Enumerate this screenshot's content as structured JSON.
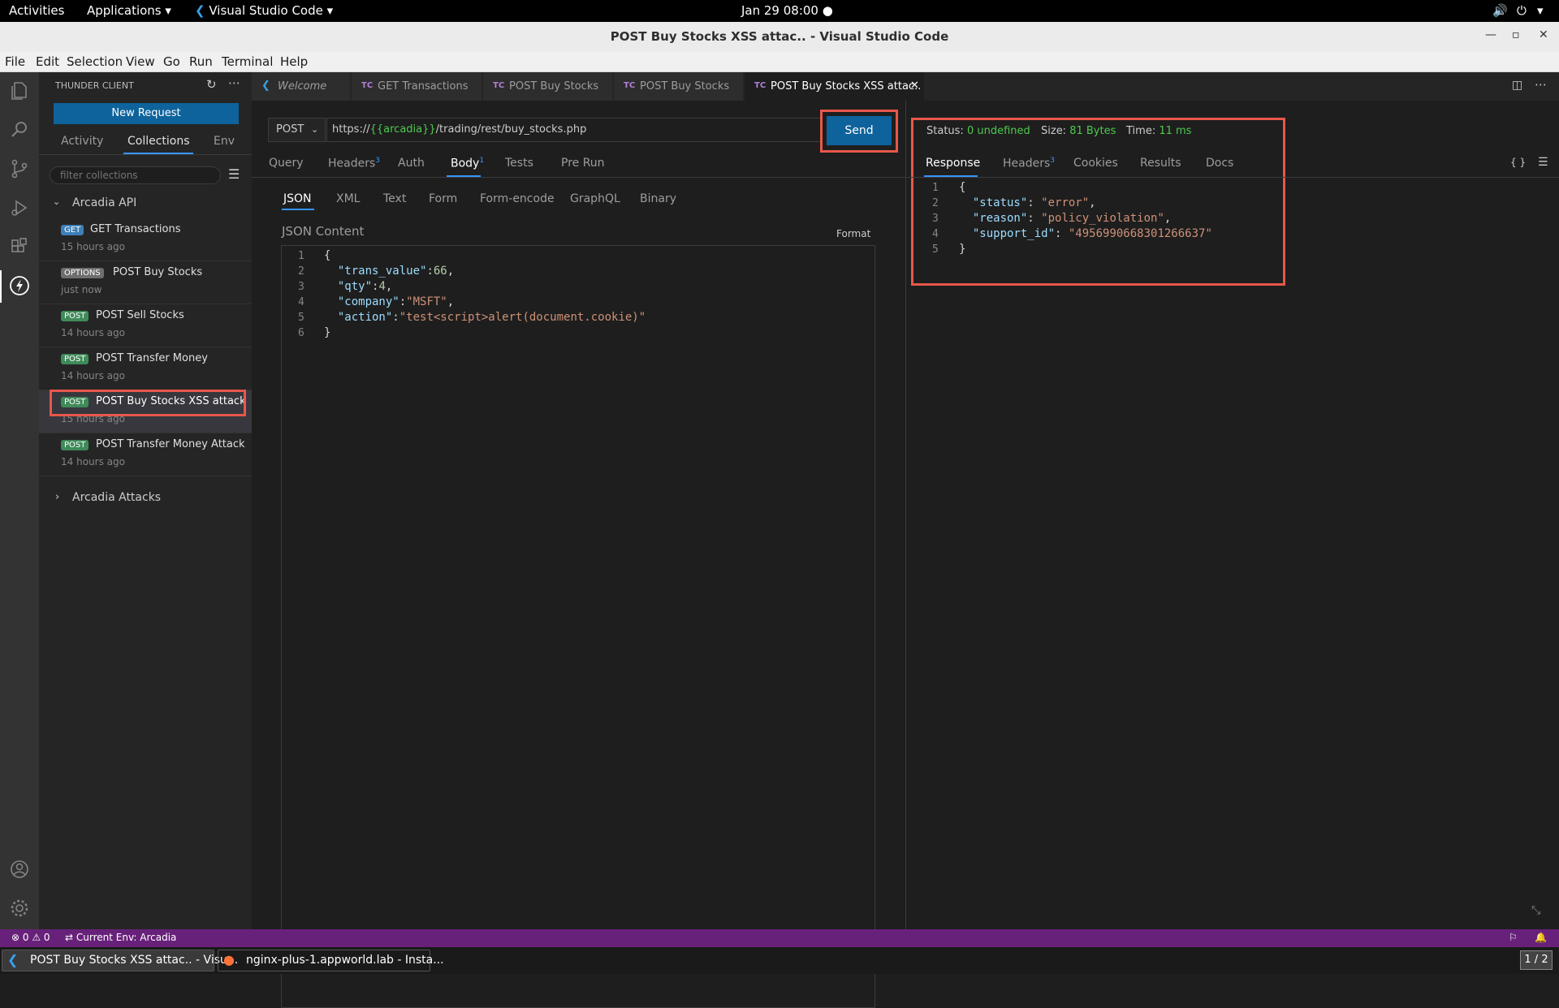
{
  "gnome": {
    "activities": "Activities",
    "applications": "Applications",
    "app_name": "Visual Studio Code",
    "clock": "Jan 29  08:00"
  },
  "window": {
    "title": "POST Buy Stocks XSS attac.. - Visual Studio Code"
  },
  "menu": [
    "File",
    "Edit",
    "Selection",
    "View",
    "Go",
    "Run",
    "Terminal",
    "Help"
  ],
  "sidebar": {
    "header": "THUNDER CLIENT",
    "new_request": "New Request",
    "tabs": [
      "Activity",
      "Collections",
      "Env"
    ],
    "filter_placeholder": "filter collections",
    "collection_name": "Arcadia API",
    "requests": [
      {
        "method": "GET",
        "name": "GET Transactions",
        "time": "15 hours ago"
      },
      {
        "method": "OPTIONS",
        "name": "POST Buy Stocks",
        "time": "just now"
      },
      {
        "method": "POST",
        "name": "POST Sell Stocks",
        "time": "14 hours ago"
      },
      {
        "method": "POST",
        "name": "POST Transfer Money",
        "time": "14 hours ago"
      },
      {
        "method": "POST",
        "name": "POST Buy Stocks XSS attack",
        "time": "15 hours ago"
      },
      {
        "method": "POST",
        "name": "POST Transfer Money Attack",
        "time": "14 hours ago"
      }
    ],
    "collection2": "Arcadia Attacks"
  },
  "tabs": [
    {
      "label": "Welcome"
    },
    {
      "label": "GET Transactions"
    },
    {
      "label": "POST Buy Stocks"
    },
    {
      "label": "POST Buy Stocks"
    },
    {
      "label": "POST Buy Stocks XSS attac.."
    }
  ],
  "request": {
    "method": "POST",
    "url_prefix": "https://",
    "url_var": "{{arcadia}}",
    "url_suffix": "/trading/rest/buy_stocks.php",
    "send": "Send",
    "tabs": [
      "Query",
      "Headers",
      "Auth",
      "Body",
      "Tests",
      "Pre Run"
    ],
    "headers_count": "3",
    "body_count": "1",
    "body_types": [
      "JSON",
      "XML",
      "Text",
      "Form",
      "Form-encode",
      "GraphQL",
      "Binary"
    ],
    "json_content_label": "JSON Content",
    "format": "Format",
    "body": {
      "open": "{",
      "trans_value_key": "\"trans_value\"",
      "trans_value": "66",
      "qty_key": "\"qty\"",
      "qty": "4",
      "company_key": "\"company\"",
      "company": "\"MSFT\"",
      "action_key": "\"action\"",
      "action": "\"test<script>alert(document.cookie)\"",
      "close": "}"
    }
  },
  "response": {
    "status_label": "Status:",
    "status_value": "0 undefined",
    "size_label": "Size:",
    "size_value": "81 Bytes",
    "time_label": "Time:",
    "time_value": "11 ms",
    "tabs": [
      "Response",
      "Headers",
      "Cookies",
      "Results",
      "Docs"
    ],
    "headers_count": "3",
    "body": {
      "open": "{",
      "status_key": "\"status\"",
      "status": "\"error\"",
      "reason_key": "\"reason\"",
      "reason": "\"policy_violation\"",
      "support_key": "\"support_id\"",
      "support": "\"4956990668301266637\"",
      "close": "}"
    }
  },
  "status": {
    "problems": "0",
    "warnings": "0",
    "env": "Current Env: Arcadia"
  },
  "taskbar": {
    "task1": "POST Buy Stocks XSS attac.. - Visu...",
    "task2": "nginx-plus-1.appworld.lab - Insta...",
    "workspace": "1 / 2"
  },
  "colors": {
    "accent": "#0e639c",
    "status_bar": "#68217a",
    "highlight": "#e8574b",
    "success": "#4ec94e"
  }
}
